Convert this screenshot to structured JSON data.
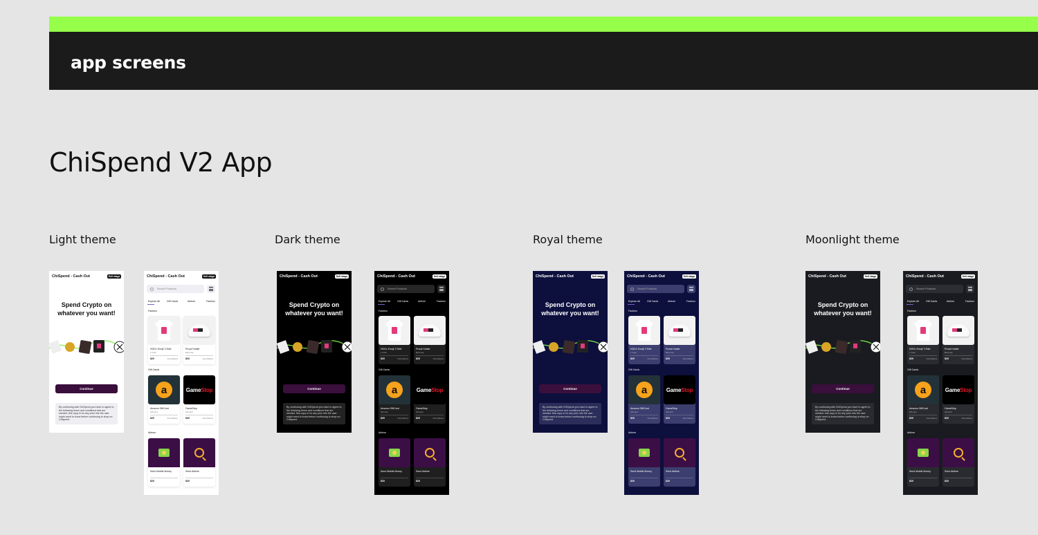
{
  "header": {
    "section_label": "app screens"
  },
  "page_title": "ChiSpend V2 App",
  "themes": [
    {
      "label": "Light theme"
    },
    {
      "label": "Dark theme"
    },
    {
      "label": "Royal theme"
    },
    {
      "label": "Moonlight theme"
    }
  ],
  "welcome_screen": {
    "app_title": "ChiSpend - Cash Out",
    "header_button": "Sell stage",
    "hero_line1": "Spend Crypto on",
    "hero_line2": "whatever you want!",
    "continue_label": "Continue",
    "terms_text": "By continuing with ChiSpend you have to agree to the following terms and conditions that are needed. this copy is for any prior info the user might need to know before continuing to shop on Chispend."
  },
  "product_screen": {
    "app_title": "ChiSpend - Cash Out",
    "header_button": "Sell stage",
    "search_placeholder": "Search Products",
    "tabs": [
      "Explore All",
      "Gift Cards",
      "Airtime",
      "Fashion"
    ],
    "sections": {
      "fashion": "Fashion",
      "gift_cards": "Gift Cards",
      "airtime": "Airtime"
    },
    "products": {
      "hodl_tshirt": {
        "name": "HODL Emoji T-Shirt",
        "sub": "1 Color",
        "price": "$20",
        "delivery": "Free Delivery"
      },
      "proud_holder": {
        "name": "Proud Holder",
        "sub": "Best Cap",
        "price": "$20",
        "delivery": "Free Delivery"
      },
      "amazon": {
        "name": "Amazon GiftCard",
        "sub": "Gift card",
        "price": "$20",
        "delivery": "Free Delivery"
      },
      "gamestop": {
        "name": "GameStop",
        "sub": "Gift card",
        "price": "$20",
        "delivery": "Free Delivery"
      },
      "mobile_money": {
        "name": "Send Mobile Money",
        "price": "$20"
      },
      "send_airtime": {
        "name": "Send Airtime",
        "price": "$20"
      }
    }
  },
  "theme_colors": {
    "light": "#ffffff",
    "dark": "#000000",
    "royal": "#0d0f3d",
    "moonlight": "#1a1b20",
    "accent_green": "#95ff4a",
    "continue_purple": "#3a0f3c"
  }
}
